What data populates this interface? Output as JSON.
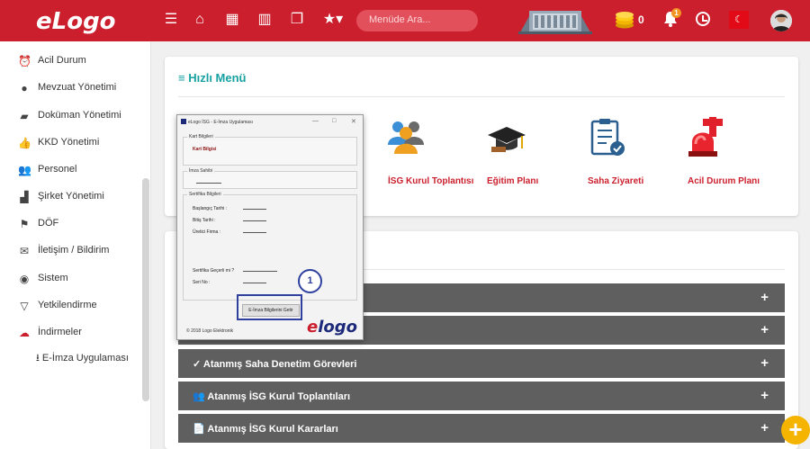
{
  "header": {
    "logo": "eLogo",
    "search_placeholder": "Menüde Ara...",
    "coin_count": "0",
    "notification_count": "1",
    "flag": "☾"
  },
  "sidebar": {
    "items": [
      {
        "label": "Acil Durum",
        "icon": "alarm-icon"
      },
      {
        "label": "Mevzuat Yönetimi",
        "icon": "info-icon"
      },
      {
        "label": "Doküman Yönetimi",
        "icon": "folder-icon"
      },
      {
        "label": "KKD Yönetimi",
        "icon": "thumbs-up-icon"
      },
      {
        "label": "Personel",
        "icon": "users-icon"
      },
      {
        "label": "Şirket Yönetimi",
        "icon": "chart-icon"
      },
      {
        "label": "DÖF",
        "icon": "flag-icon"
      },
      {
        "label": "İletişim / Bildirim",
        "icon": "envelope-icon"
      },
      {
        "label": "Sistem",
        "icon": "globe-icon"
      },
      {
        "label": "Yetkilendirme",
        "icon": "filter-icon"
      },
      {
        "label": "İndirmeler",
        "icon": "cloud-download-icon"
      }
    ],
    "sub_item": "E-İmza Uygulaması"
  },
  "quick_menu": {
    "title": "Hızlı Menü",
    "items": [
      {
        "label": "İSG Kurul Toplantısı",
        "icon": "meeting-icon"
      },
      {
        "label": "Eğitim Planı",
        "icon": "graduation-cap-icon"
      },
      {
        "label": "Saha Ziyareti",
        "icon": "checklist-icon"
      },
      {
        "label": "Acil Durum Planı",
        "icon": "siren-icon"
      }
    ]
  },
  "accordions": [
    {
      "label": "",
      "icon": ""
    },
    {
      "label": "",
      "icon": ""
    },
    {
      "label": "Atanmış Saha Denetim Görevleri",
      "icon": "✓"
    },
    {
      "label": "Atanmış İSG Kurul Toplantıları",
      "icon": "👥"
    },
    {
      "label": "Atanmış İSG Kurul Kararları",
      "icon": "📄"
    }
  ],
  "dialog": {
    "title": "eLogo İSG - E-İmza Uygulaması",
    "card_group": "Kart Bilgileri",
    "card_value": "Kart Bilgisi",
    "signer_group": "İmza Sahibi",
    "cert_group": "Sertifika Bilgileri",
    "start_date": "Başlangıç Tarihi :",
    "end_date": "Bitiş Tarihi :",
    "issuer": "Üretici Firma :",
    "valid": "Sertifika Geçerli mi ?",
    "serial": "Seri No :",
    "button": "E-İmza Bilgilerini Getir",
    "copyright": "© 2018 Logo Elektronik",
    "brand_e": "e",
    "brand_logo": "logo",
    "step": "1"
  }
}
